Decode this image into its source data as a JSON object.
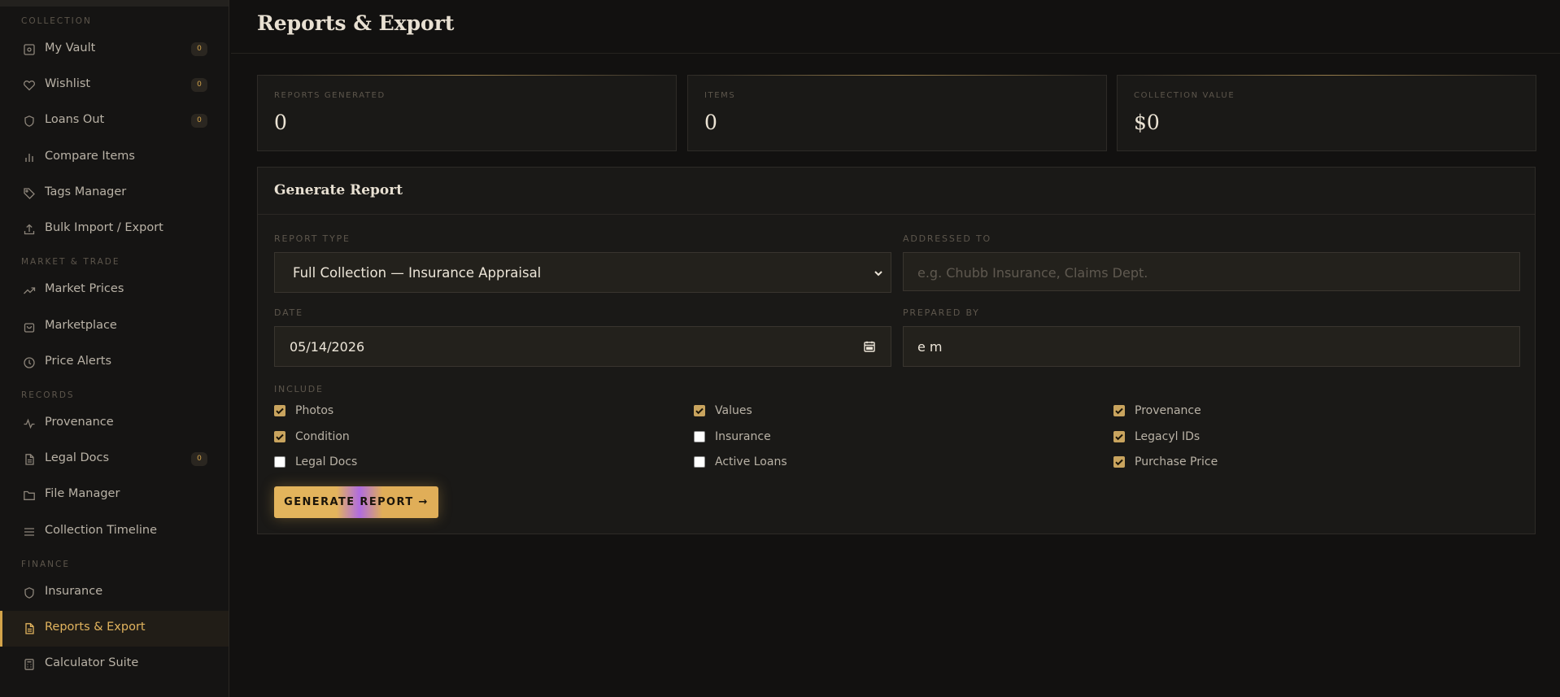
{
  "sidebar": {
    "sections": [
      "COLLECTION",
      "MARKET & TRADE",
      "RECORDS",
      "FINANCE"
    ],
    "items": [
      {
        "label": "My Vault",
        "icon": "vault-icon",
        "badge": "0"
      },
      {
        "label": "Wishlist",
        "icon": "heart-icon",
        "badge": "0"
      },
      {
        "label": "Loans Out",
        "icon": "shield-icon",
        "badge": "0"
      },
      {
        "label": "Compare Items",
        "icon": "bar-chart-icon"
      },
      {
        "label": "Tags Manager",
        "icon": "tag-icon"
      },
      {
        "label": "Bulk Import / Export",
        "icon": "upload-icon"
      },
      {
        "label": "Market Prices",
        "icon": "trending-up-icon"
      },
      {
        "label": "Marketplace",
        "icon": "shopping-bag-icon"
      },
      {
        "label": "Price Alerts",
        "icon": "alert-circle-icon"
      },
      {
        "label": "Provenance",
        "icon": "activity-icon"
      },
      {
        "label": "Legal Docs",
        "icon": "document-icon",
        "badge": "0"
      },
      {
        "label": "File Manager",
        "icon": "folder-icon"
      },
      {
        "label": "Collection Timeline",
        "icon": "list-icon"
      },
      {
        "label": "Insurance",
        "icon": "shield-icon"
      },
      {
        "label": "Reports & Export",
        "icon": "report-icon",
        "active": true
      },
      {
        "label": "Calculator Suite",
        "icon": "calculator-icon"
      }
    ]
  },
  "main": {
    "title": "Reports & Export",
    "stats": [
      {
        "label": "REPORTS GENERATED",
        "value": "0"
      },
      {
        "label": "ITEMS",
        "value": "0"
      },
      {
        "label": "COLLECTION VALUE",
        "value": "$0"
      }
    ],
    "form": {
      "title": "Generate Report",
      "report_type_label": "REPORT TYPE",
      "report_type_value": "Full Collection — Insurance Appraisal",
      "addressed_to_label": "ADDRESSED TO",
      "addressed_to_placeholder": "e.g. Chubb Insurance, Claims Dept.",
      "date_label": "DATE",
      "date_value": "05/14/2026",
      "prepared_by_label": "PREPARED BY",
      "prepared_by_value": "e m",
      "include_label": "INCLUDE",
      "include": [
        {
          "label": "Photos",
          "checked": true
        },
        {
          "label": "Values",
          "checked": true
        },
        {
          "label": "Provenance",
          "checked": true
        },
        {
          "label": "Condition",
          "checked": true
        },
        {
          "label": "Insurance",
          "checked": false
        },
        {
          "label": "Legacyl IDs",
          "checked": true
        },
        {
          "label": "Legal Docs",
          "checked": false
        },
        {
          "label": "Active Loans",
          "checked": false
        },
        {
          "label": "Purchase Price",
          "checked": true
        }
      ],
      "generate_label": "GENERATE REPORT →"
    }
  },
  "colors": {
    "accent": "#d4a44a",
    "background": "#121110",
    "panel": "#1a1917"
  }
}
